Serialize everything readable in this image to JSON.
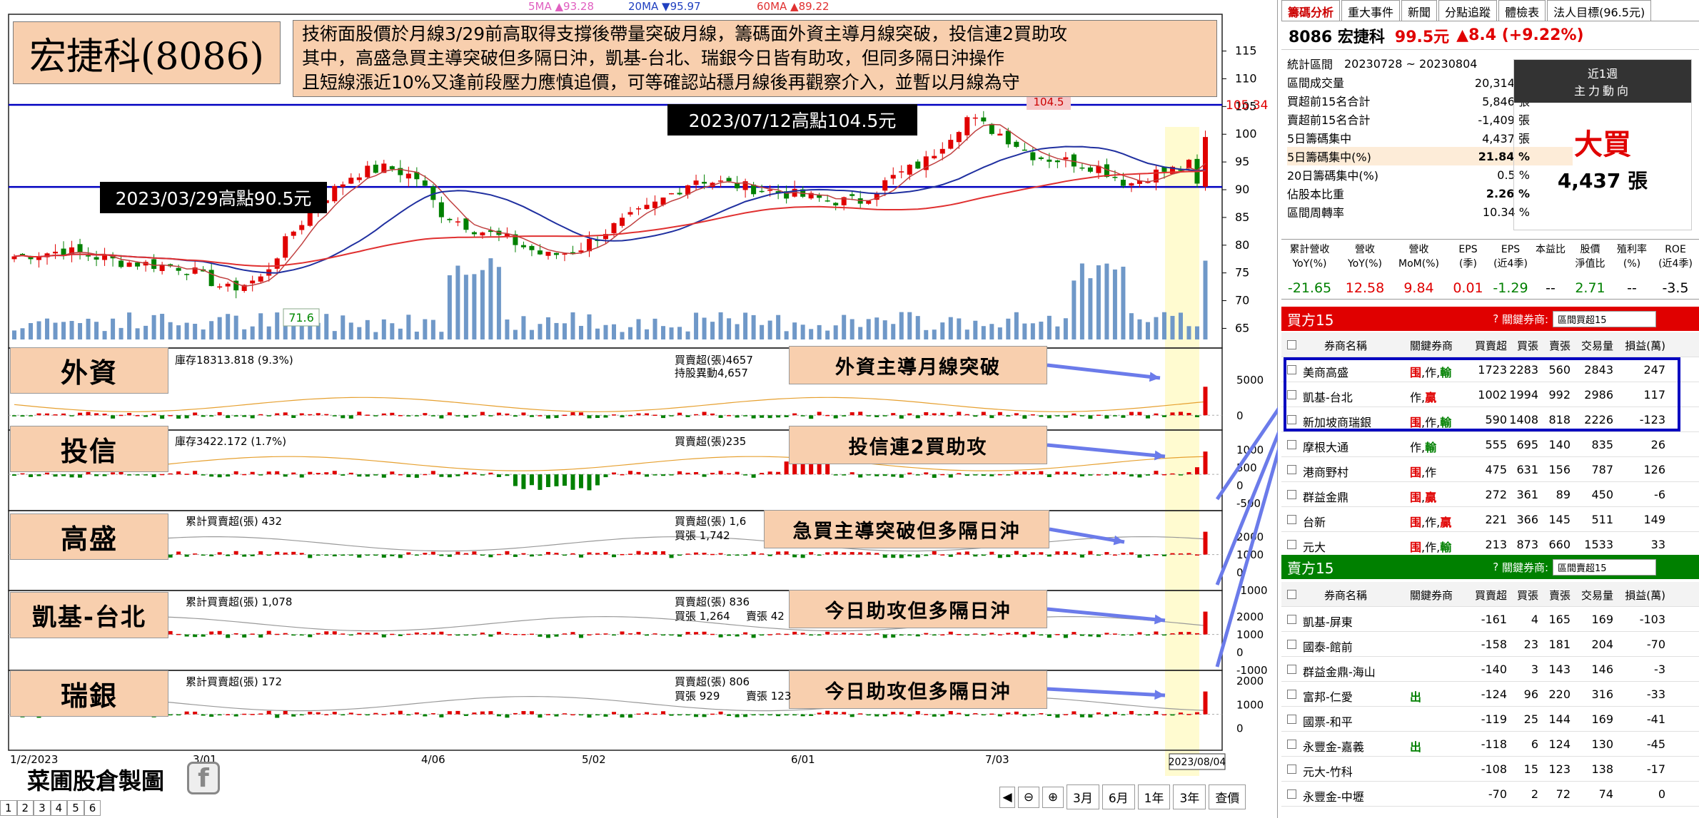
{
  "chart": {
    "ma_legend": [
      {
        "text": "5MA ▲93.28",
        "color": "#e060c0"
      },
      {
        "text": "20MA ▼95.97",
        "color": "#2040c0"
      },
      {
        "text": "60MA ▲89.22",
        "color": "#e03030"
      }
    ],
    "price_ticks": [
      "115",
      "110",
      "105",
      "100",
      "95",
      "90",
      "85",
      "80",
      "75",
      "70",
      "65"
    ],
    "current_price_label": "105.34",
    "low_label": "71.6",
    "high_label": "104.5",
    "x_labels": [
      "1/2/2023",
      "3/01",
      "4/06",
      "5/02",
      "6/01",
      "7/03",
      "2023/08/04"
    ],
    "sub1": {
      "stock_label": "庫存18313.818 (9.3%)",
      "net_label": "買賣超(張)4657",
      "hold_label": "持股異動4,657",
      "ticks": [
        "5000",
        "0"
      ]
    },
    "sub2": {
      "stock_label": "庫存3422.172 (1.7%)",
      "net_label": "買賣超(張)235",
      "ticks": [
        "1000",
        "500",
        "0",
        "-500"
      ]
    },
    "sub3": {
      "cum_label": "累計買賣超(張) 432",
      "net_label": "買賣超(張) 1,6",
      "buy_label": "買張 1,742",
      "ticks": [
        "2000",
        "1000",
        "0",
        "-1000"
      ]
    },
    "sub4": {
      "cum_label": "累計買賣超(張) 1,078",
      "net_label": "買賣超(張) 836",
      "buy_label": "買張 1,264",
      "sell_label": "賣張 42",
      "ticks": [
        "2000",
        "1000",
        "0",
        "-1000"
      ]
    },
    "sub5": {
      "cum_label": "累計買賣超(張) 172",
      "net_label": "買賣超(張) 806",
      "buy_label": "買張 929",
      "sell_label": "賣張 123",
      "ticks": [
        "2000",
        "1000",
        "0"
      ]
    },
    "toolbar": {
      "months": [
        "3月",
        "6月",
        "1年",
        "3年"
      ],
      "query": "查價"
    },
    "pager": [
      "1",
      "2",
      "3",
      "4",
      "5",
      "6"
    ]
  },
  "overlay": {
    "title": "宏捷科(8086)",
    "commentary": [
      "技術面股價於月線3/29前高取得支撐後帶量突破月線，籌碼面外資主導月線突破，投信連2買助攻",
      "其中，高盛急買主導突破但多隔日沖，凱基-台北、瑞銀今日皆有助攻，但同多隔日沖操作",
      "且短線漲近10%又逢前段壓力應慎追價，可等確認站穩月線後再觀察介入，並暫以月線為守"
    ],
    "high_0712": "2023/07/12高點104.5元",
    "high_0329": "2023/03/29高點90.5元",
    "labels": [
      "外資",
      "投信",
      "高盛",
      "凱基-台北",
      "瑞銀"
    ],
    "notes": [
      "外資主導月線突破",
      "投信連2買助攻",
      "急買主導突破但多隔日沖",
      "今日助攻但多隔日沖",
      "今日助攻但多隔日沖"
    ],
    "watermark": "菜圃股倉製圖"
  },
  "panel": {
    "tabs": [
      "籌碼分析",
      "重大事件",
      "新聞",
      "分點追蹤",
      "體檢表",
      "法人目標(96.5元)"
    ],
    "stock_name": "8086 宏捷科",
    "price": "99.5元",
    "change": "▲8.4 (+9.22%)",
    "stats": [
      {
        "k": "統計區間",
        "v": "20230728 ~ 20230804"
      },
      {
        "k": "區間成交量",
        "v": "20,314 張"
      },
      {
        "k": "買超前15名合計",
        "v": "5,846 張"
      },
      {
        "k": "賣超前15名合計",
        "v": "-1,409 張"
      },
      {
        "k": "5日籌碼集中",
        "v": "4,437 張"
      },
      {
        "k": "5日籌碼集中(%)",
        "v": "21.84 %"
      },
      {
        "k": "20日籌碼集中(%)",
        "v": "0.5 %"
      },
      {
        "k": "佔股本比重",
        "v": "2.26 %"
      },
      {
        "k": "區間周轉率",
        "v": "10.34 %"
      }
    ],
    "period": "近1週",
    "main_force": "主力動向",
    "verdict": "大買",
    "verdict_value": "4,437 張",
    "fin_headers": [
      "累計營收\nYoY(%)",
      "營收\nYoY(%)",
      "營收\nMoM(%)",
      "EPS\n(季)",
      "EPS\n(近4季)",
      "本益比",
      "股價\n淨值比",
      "殖利率\n(%)",
      "ROE\n(近4季)"
    ],
    "fin_values": [
      "-21.65",
      "12.58",
      "9.84",
      "0.01",
      "-1.29",
      "--",
      "2.71",
      "--",
      "-3.5"
    ],
    "buy_title": "買方15",
    "sell_title": "賣方15",
    "key_label": "關鍵券商:",
    "buy_select": "區間買超15",
    "sell_select": "區間賣超15",
    "cols": [
      "券商名稱",
      "關鍵券商",
      "買賣超",
      "買張",
      "賣張",
      "交易量",
      "損益(萬)"
    ],
    "buy_rows": [
      [
        "美商高盛",
        "围,作,輸",
        "1723",
        "2283",
        "560",
        "2843",
        "247"
      ],
      [
        "凱基-台北",
        "作,贏",
        "1002",
        "1994",
        "992",
        "2986",
        "117"
      ],
      [
        "新加坡商瑞銀",
        "围,作,輸",
        "590",
        "1408",
        "818",
        "2226",
        "-123"
      ],
      [
        "摩根大通",
        "作,輸",
        "555",
        "695",
        "140",
        "835",
        "26"
      ],
      [
        "港商野村",
        "围,作",
        "475",
        "631",
        "156",
        "787",
        "126"
      ],
      [
        "群益金鼎",
        "围,贏",
        "272",
        "361",
        "89",
        "450",
        "-6"
      ],
      [
        "台新",
        "围,作,贏",
        "221",
        "366",
        "145",
        "511",
        "149"
      ],
      [
        "元大",
        "围,作,輸",
        "213",
        "873",
        "660",
        "1533",
        "33"
      ]
    ],
    "sell_rows": [
      [
        "凱基-屏東",
        "",
        "-161",
        "4",
        "165",
        "169",
        "-103"
      ],
      [
        "國泰-館前",
        "",
        "-158",
        "23",
        "181",
        "204",
        "-70"
      ],
      [
        "群益金鼎-海山",
        "",
        "-140",
        "3",
        "143",
        "146",
        "-3"
      ],
      [
        "富邦-仁愛",
        "出",
        "-124",
        "96",
        "220",
        "316",
        "-33"
      ],
      [
        "國票-和平",
        "",
        "-119",
        "25",
        "144",
        "169",
        "-41"
      ],
      [
        "永豐金-嘉義",
        "出",
        "-118",
        "6",
        "124",
        "130",
        "-45"
      ],
      [
        "元大-竹科",
        "",
        "-108",
        "15",
        "123",
        "138",
        "-17"
      ],
      [
        "永豐金-中壢",
        "",
        "-70",
        "2",
        "72",
        "74",
        "0"
      ]
    ]
  }
}
